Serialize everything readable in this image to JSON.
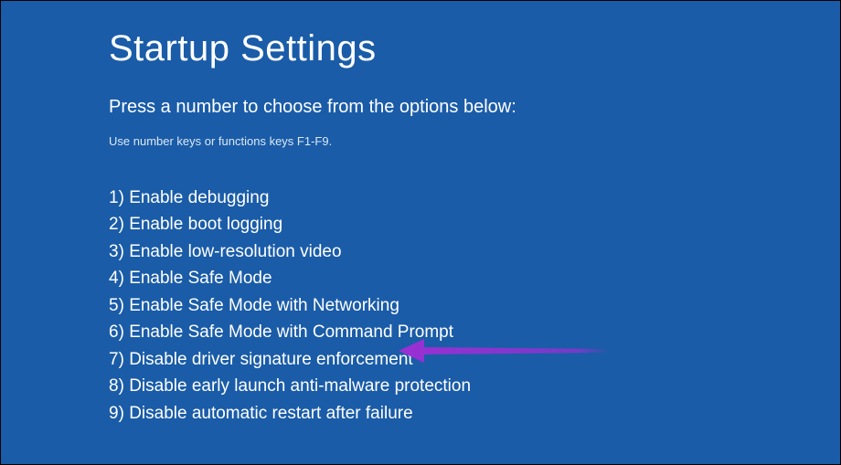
{
  "title": "Startup Settings",
  "subtitle": "Press a number to choose from the options below:",
  "hint": "Use number keys or functions keys F1-F9.",
  "options": [
    {
      "num": "1)",
      "label": "Enable debugging"
    },
    {
      "num": "2)",
      "label": "Enable boot logging"
    },
    {
      "num": "3)",
      "label": "Enable low-resolution video"
    },
    {
      "num": "4)",
      "label": "Enable Safe Mode"
    },
    {
      "num": "5)",
      "label": "Enable Safe Mode with Networking"
    },
    {
      "num": "6)",
      "label": "Enable Safe Mode with Command Prompt"
    },
    {
      "num": "7)",
      "label": "Disable driver signature enforcement"
    },
    {
      "num": "8)",
      "label": "Disable early launch anti-malware protection"
    },
    {
      "num": "9)",
      "label": "Disable automatic restart after failure"
    }
  ],
  "arrow_color": "#9b2fd4"
}
